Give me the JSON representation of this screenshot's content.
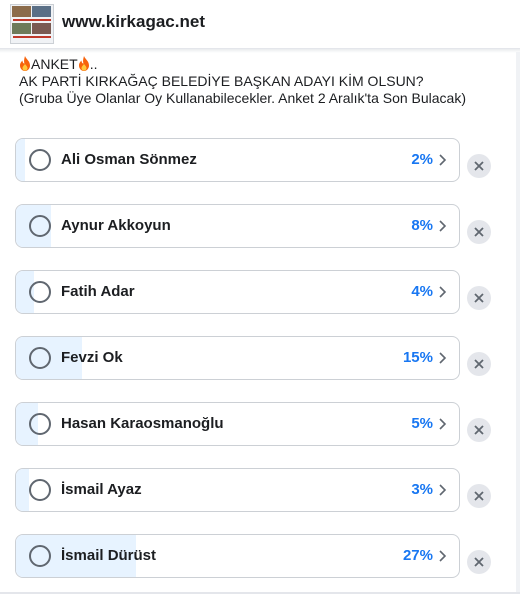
{
  "header": {
    "page_name": "www.kirkagac.net",
    "avatar_icon": "page-avatar-icon"
  },
  "post": {
    "line1": "ANKET",
    "line1_suffix": "..",
    "line2": "AK PARTİ KIRKAĞAÇ BELEDİYE BAŞKAN ADAYI KİM OLSUN?",
    "line3": "(Gruba Üye Olanlar Oy Kullanabilecekler. Anket 2 Aralık'ta Son Bulacak)",
    "emoji_icon": "fire-icon"
  },
  "poll": {
    "accent_color": "#1877f2",
    "fill_color": "#e7f3ff",
    "options": [
      {
        "label": "Ali Osman Sönmez",
        "percent_text": "2%",
        "percent": 2
      },
      {
        "label": "Aynur Akkoyun",
        "percent_text": "8%",
        "percent": 8
      },
      {
        "label": "Fatih Adar",
        "percent_text": "4%",
        "percent": 4
      },
      {
        "label": "Fevzi Ok",
        "percent_text": "15%",
        "percent": 15
      },
      {
        "label": "Hasan Karaosmanoğlu",
        "percent_text": "5%",
        "percent": 5
      },
      {
        "label": "İsmail Ayaz",
        "percent_text": "3%",
        "percent": 3
      },
      {
        "label": "İsmail Dürüst",
        "percent_text": "27%",
        "percent": 27
      }
    ]
  }
}
